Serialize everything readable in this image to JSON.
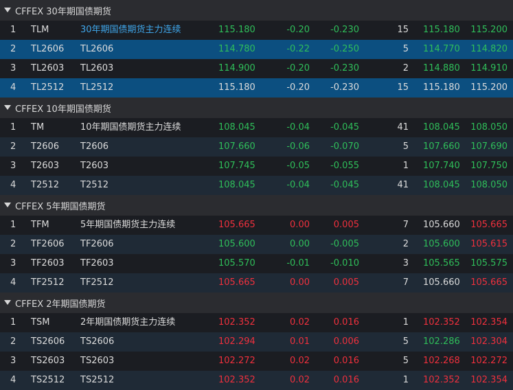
{
  "colors": {
    "up": "#f0303d",
    "down": "#2fbf5a",
    "flat": "#dcdcdc",
    "link": "#3fa6ea",
    "selected_row": "#0c4f80",
    "header_bg": "#2b2c30"
  },
  "groups": [
    {
      "title": "CFFEX 30年期国债期货",
      "rows": [
        {
          "idx": "1",
          "code": "TLM",
          "name": "30年期国债期货主力连续",
          "last": "115.180",
          "chg": "-0.20",
          "pct": "-0.230",
          "vol": "15",
          "bid": "115.180",
          "ask": "115.200",
          "c": [
            "down",
            "down",
            "down",
            "down",
            "down"
          ],
          "link": true,
          "sel": false
        },
        {
          "idx": "2",
          "code": "TL2606",
          "name": "TL2606",
          "last": "114.780",
          "chg": "-0.22",
          "pct": "-0.250",
          "vol": "5",
          "bid": "114.770",
          "ask": "114.820",
          "c": [
            "down",
            "down",
            "down",
            "down",
            "down"
          ],
          "sel": true
        },
        {
          "idx": "3",
          "code": "TL2603",
          "name": "TL2603",
          "last": "114.900",
          "chg": "-0.20",
          "pct": "-0.230",
          "vol": "2",
          "bid": "114.880",
          "ask": "114.910",
          "c": [
            "down",
            "down",
            "down",
            "down",
            "down"
          ],
          "sel": false
        },
        {
          "idx": "4",
          "code": "TL2512",
          "name": "TL2512",
          "last": "115.180",
          "chg": "-0.20",
          "pct": "-0.230",
          "vol": "15",
          "bid": "115.180",
          "ask": "115.200",
          "c": [
            "flat",
            "flat",
            "flat",
            "flat",
            "flat"
          ],
          "sel": true
        }
      ]
    },
    {
      "title": "CFFEX 10年期国债期货",
      "rows": [
        {
          "idx": "1",
          "code": "TM",
          "name": "10年期国债期货主力连续",
          "last": "108.045",
          "chg": "-0.04",
          "pct": "-0.045",
          "vol": "41",
          "bid": "108.045",
          "ask": "108.050",
          "c": [
            "down",
            "down",
            "down",
            "down",
            "down"
          ]
        },
        {
          "idx": "2",
          "code": "T2606",
          "name": "T2606",
          "last": "107.660",
          "chg": "-0.06",
          "pct": "-0.070",
          "vol": "5",
          "bid": "107.660",
          "ask": "107.690",
          "c": [
            "down",
            "down",
            "down",
            "down",
            "down"
          ]
        },
        {
          "idx": "3",
          "code": "T2603",
          "name": "T2603",
          "last": "107.745",
          "chg": "-0.05",
          "pct": "-0.055",
          "vol": "1",
          "bid": "107.740",
          "ask": "107.750",
          "c": [
            "down",
            "down",
            "down",
            "down",
            "down"
          ]
        },
        {
          "idx": "4",
          "code": "T2512",
          "name": "T2512",
          "last": "108.045",
          "chg": "-0.04",
          "pct": "-0.045",
          "vol": "41",
          "bid": "108.045",
          "ask": "108.050",
          "c": [
            "down",
            "down",
            "down",
            "down",
            "down"
          ]
        }
      ]
    },
    {
      "title": "CFFEX 5年期国债期货",
      "rows": [
        {
          "idx": "1",
          "code": "TFM",
          "name": "5年期国债期货主力连续",
          "last": "105.665",
          "chg": "0.00",
          "pct": "0.005",
          "vol": "7",
          "bid": "105.660",
          "ask": "105.665",
          "c": [
            "up",
            "up",
            "up",
            "flat",
            "up"
          ]
        },
        {
          "idx": "2",
          "code": "TF2606",
          "name": "TF2606",
          "last": "105.600",
          "chg": "0.00",
          "pct": "-0.005",
          "vol": "2",
          "bid": "105.600",
          "ask": "105.615",
          "c": [
            "down",
            "down",
            "down",
            "down",
            "up"
          ]
        },
        {
          "idx": "3",
          "code": "TF2603",
          "name": "TF2603",
          "last": "105.570",
          "chg": "-0.01",
          "pct": "-0.010",
          "vol": "3",
          "bid": "105.565",
          "ask": "105.575",
          "c": [
            "down",
            "down",
            "down",
            "down",
            "down"
          ]
        },
        {
          "idx": "4",
          "code": "TF2512",
          "name": "TF2512",
          "last": "105.665",
          "chg": "0.00",
          "pct": "0.005",
          "vol": "7",
          "bid": "105.660",
          "ask": "105.665",
          "c": [
            "up",
            "up",
            "up",
            "flat",
            "up"
          ]
        }
      ]
    },
    {
      "title": "CFFEX 2年期国债期货",
      "rows": [
        {
          "idx": "1",
          "code": "TSM",
          "name": "2年期国债期货主力连续",
          "last": "102.352",
          "chg": "0.02",
          "pct": "0.016",
          "vol": "1",
          "bid": "102.352",
          "ask": "102.354",
          "c": [
            "up",
            "up",
            "up",
            "up",
            "up"
          ]
        },
        {
          "idx": "2",
          "code": "TS2606",
          "name": "TS2606",
          "last": "102.294",
          "chg": "0.01",
          "pct": "0.006",
          "vol": "5",
          "bid": "102.286",
          "ask": "102.304",
          "c": [
            "up",
            "up",
            "up",
            "down",
            "up"
          ]
        },
        {
          "idx": "3",
          "code": "TS2603",
          "name": "TS2603",
          "last": "102.272",
          "chg": "0.02",
          "pct": "0.016",
          "vol": "5",
          "bid": "102.268",
          "ask": "102.272",
          "c": [
            "up",
            "up",
            "up",
            "up",
            "up"
          ]
        },
        {
          "idx": "4",
          "code": "TS2512",
          "name": "TS2512",
          "last": "102.352",
          "chg": "0.02",
          "pct": "0.016",
          "vol": "1",
          "bid": "102.352",
          "ask": "102.354",
          "c": [
            "up",
            "up",
            "up",
            "up",
            "up"
          ]
        }
      ]
    }
  ]
}
